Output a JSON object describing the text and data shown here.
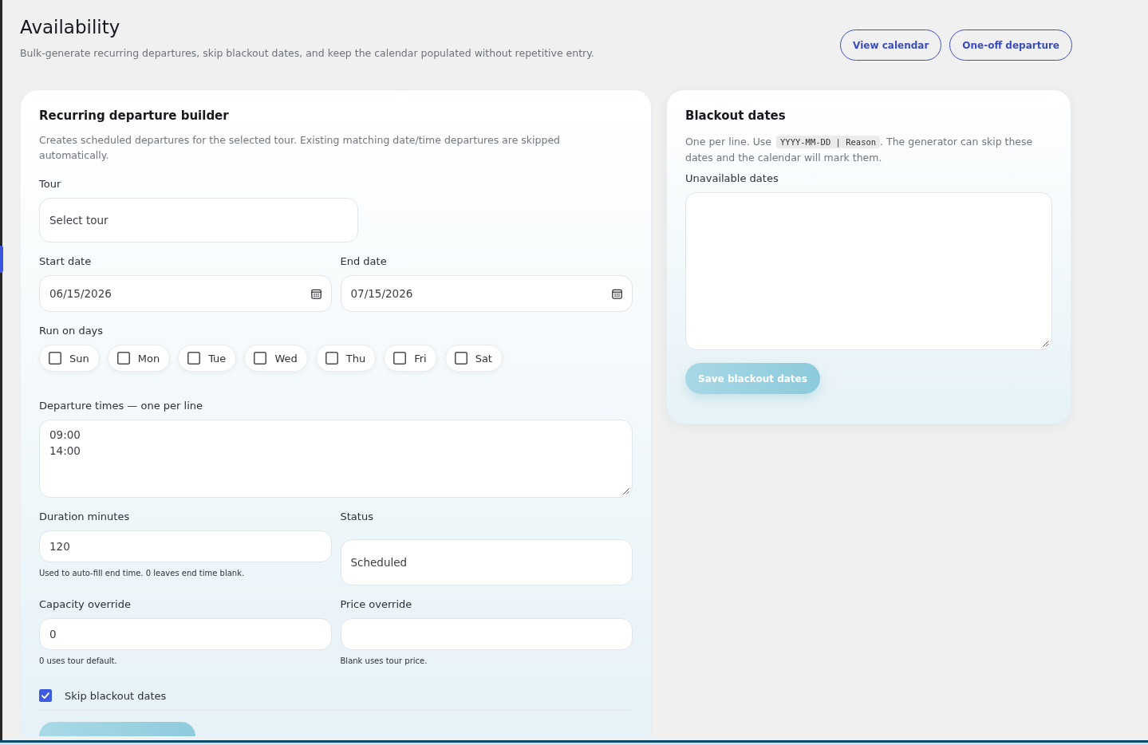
{
  "header": {
    "title": "Availability",
    "subtitle": "Bulk-generate recurring departures, skip blackout dates, and keep the calendar populated without repetitive entry.",
    "actions": [
      {
        "label": "View calendar"
      },
      {
        "label": "One-off departure"
      }
    ]
  },
  "builder": {
    "title": "Recurring departure builder",
    "description": "Creates scheduled departures for the selected tour. Existing matching date/time departures are skipped automatically.",
    "tour": {
      "label": "Tour",
      "value": "Select tour"
    },
    "start_date": {
      "label": "Start date",
      "value": "06/15/2026"
    },
    "end_date": {
      "label": "End date",
      "value": "07/15/2026"
    },
    "run_on_days": {
      "label": "Run on days",
      "days": [
        {
          "label": "Sun",
          "checked": false
        },
        {
          "label": "Mon",
          "checked": false
        },
        {
          "label": "Tue",
          "checked": false
        },
        {
          "label": "Wed",
          "checked": false
        },
        {
          "label": "Thu",
          "checked": false
        },
        {
          "label": "Fri",
          "checked": false
        },
        {
          "label": "Sat",
          "checked": false
        }
      ]
    },
    "departure_times": {
      "label": "Departure times — one per line",
      "value": "09:00\n14:00"
    },
    "duration": {
      "label": "Duration minutes",
      "value": "120",
      "help": "Used to auto-fill end time. 0 leaves end time blank."
    },
    "status": {
      "label": "Status",
      "value": "Scheduled"
    },
    "capacity": {
      "label": "Capacity override",
      "value": "0",
      "help": "0 uses tour default."
    },
    "price": {
      "label": "Price override",
      "help": "Blank uses tour price."
    },
    "skip_blackout": {
      "label": "Skip blackout dates",
      "checked": true
    }
  },
  "blackout": {
    "title": "Blackout dates",
    "help": {
      "before": "One per line. Use",
      "code": "YYYY-MM-DD | Reason",
      "after": ". The generator can skip these dates and the calendar will mark them."
    },
    "dates": {
      "label": "Unavailable dates"
    },
    "save_button": {
      "label": "Save blackout dates"
    }
  }
}
